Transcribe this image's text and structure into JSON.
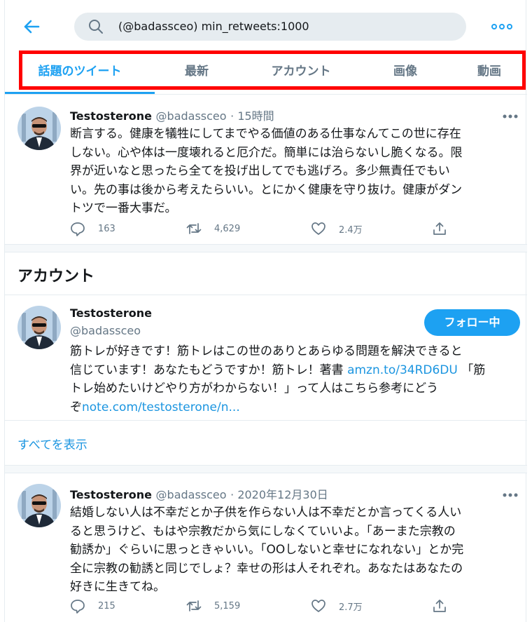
{
  "search": {
    "query": "(@badassceo) min_retweets:1000"
  },
  "tabs": [
    {
      "label": "話題のツイート",
      "active": true
    },
    {
      "label": "最新",
      "active": false
    },
    {
      "label": "アカウント",
      "active": false
    },
    {
      "label": "画像",
      "active": false
    },
    {
      "label": "動画",
      "active": false
    }
  ],
  "tweets": [
    {
      "display_name": "Testosterone",
      "handle": "@badassceo",
      "time": "· 15時間",
      "lines": [
        "断言する。健康を犠牲にしてまでやる価値のある仕事なんてこの世に存在",
        "しない。心や体は一度壊れると厄介だ。簡単には治らないし脆くなる。限",
        "界が近いなと思ったら全てを投げ出してでも逃げろ。多少無責任でもい",
        "い。先の事は後から考えたらいい。とにかく健康を守り抜け。健康がダン",
        "トツで一番大事だ。"
      ],
      "replies": "163",
      "retweets": "4,629",
      "likes": "2.4万"
    },
    {
      "display_name": "Testosterone",
      "handle": "@badassceo",
      "time": "· 2020年12月30日",
      "lines": [
        "結婚しない人は不幸だとか子供を作らない人は不幸だとか言ってくる人い",
        "ると思うけど、もはや宗教だから気にしなくていいよ。「あーまた宗教の",
        "勧誘か」ぐらいに思っときゃいい。「OOしないと幸せになれない」とか完",
        "全に宗教の勧誘と同じでしょ？幸せの形は人それぞれ。あなたはあなたの",
        "好きに生きてね。"
      ],
      "replies": "215",
      "retweets": "5,159",
      "likes": "2.7万"
    }
  ],
  "accounts_section": {
    "title": "アカウント",
    "display_name": "Testosterone",
    "handle": "@badassceo",
    "follow_label": "フォロー中",
    "bio_line1": "筋トレが好きです！筋トレはこの世のありとあらゆる問題を解決できると",
    "bio_line2": "信じています！あなたもどうですか！筋トレ！著書 ",
    "bio_link1": "amzn.to/34RD6DU",
    "bio_line2b": " 「筋",
    "bio_line3": "トレ始めたいけどやり方がわからない！」って人はこちら参考にどう",
    "bio_line4a": "ぞ",
    "bio_link2": "note.com/testosterone/n...",
    "show_all": "すべてを表示"
  },
  "colors": {
    "accent": "#1da1f2",
    "highlight_box": "#ff0000",
    "muted": "#657786"
  },
  "icons": [
    "back-arrow-icon",
    "search-icon",
    "more-icon",
    "reply-icon",
    "retweet-icon",
    "like-icon",
    "share-icon"
  ]
}
